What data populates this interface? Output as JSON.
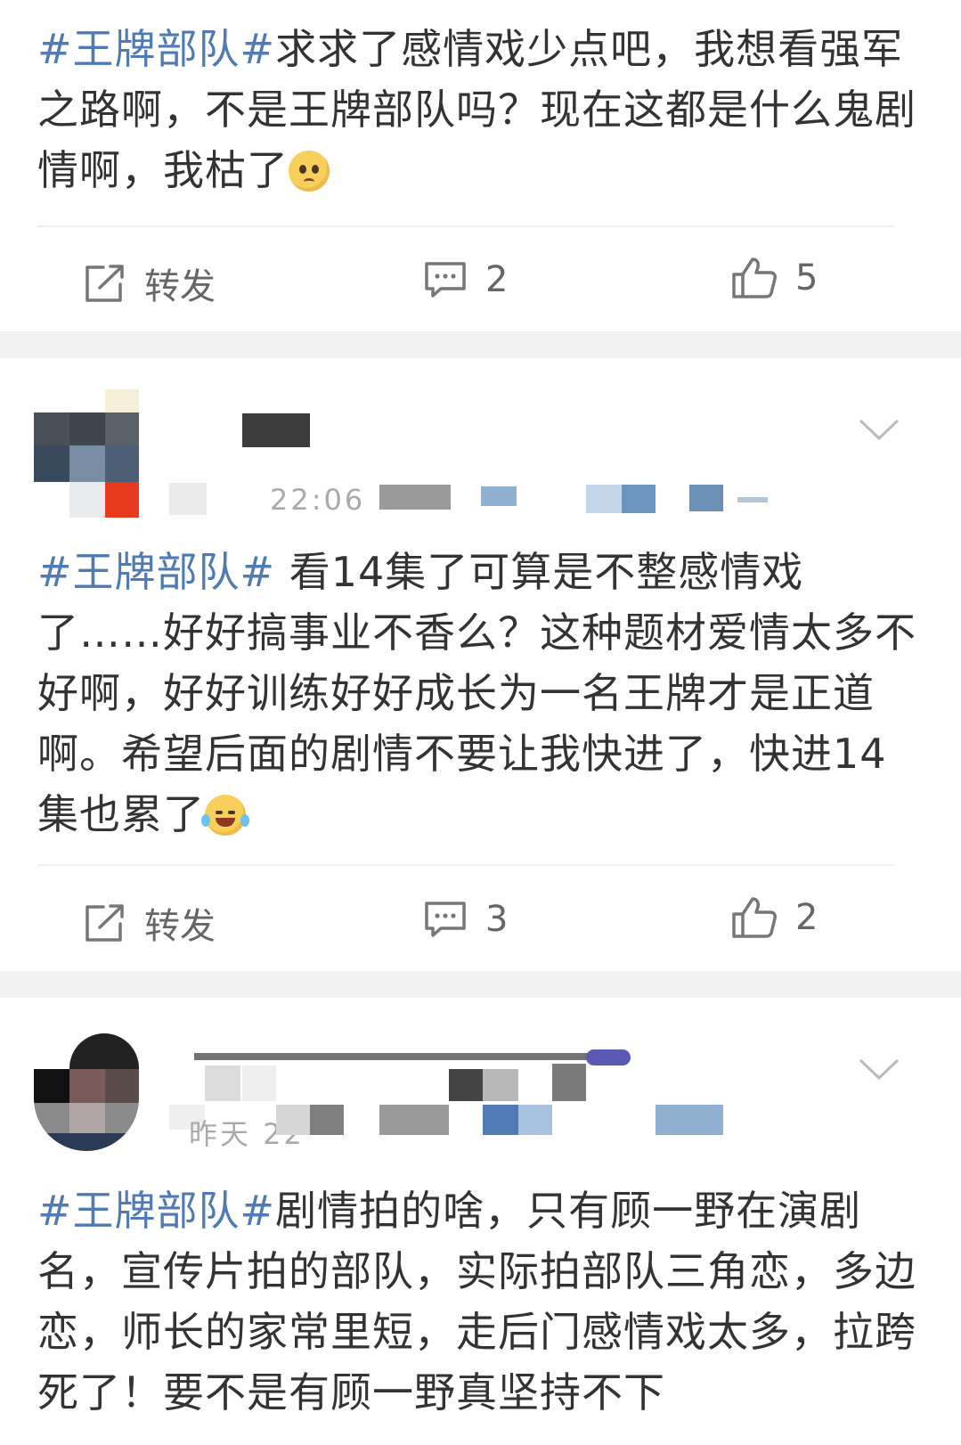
{
  "posts": [
    {
      "topic": "#王牌部队#",
      "body": "求求了感情戏少点吧，我想看强军之路啊，不是王牌部队吗？现在这都是什么鬼剧情啊，我枯了",
      "actions": {
        "repost_label": "转发",
        "comment_count": "2",
        "like_count": "5"
      }
    },
    {
      "meta_time_fragment": "22:06",
      "topic": "#王牌部队#",
      "body": " 看14集了可算是不整感情戏了……好好搞事业不香么？这种题材爱情太多不好啊，好好训练好好成长为一名王牌才是正道啊。希望后面的剧情不要让我快进了，快进14集也累了",
      "actions": {
        "repost_label": "转发",
        "comment_count": "3",
        "like_count": "2"
      }
    },
    {
      "meta_time_fragment": "昨天 22",
      "topic": "#王牌部队#",
      "body": "剧情拍的啥，只有顾一野在演剧名，宣传片拍的部队，实际拍部队三角恋，多边恋，师长的家常里短，走后门感情戏太多，拉跨死了！要不是有顾一野真坚持不下"
    }
  ],
  "icons": {
    "repost": "share-square-icon",
    "comment": "comment-bubble-icon",
    "like": "thumbs-up-icon",
    "menu": "chevron-down-icon"
  },
  "colors": {
    "topic": "#4f7ab5",
    "text": "#333333",
    "separator": "#f2f2f2",
    "action": "#666666"
  }
}
